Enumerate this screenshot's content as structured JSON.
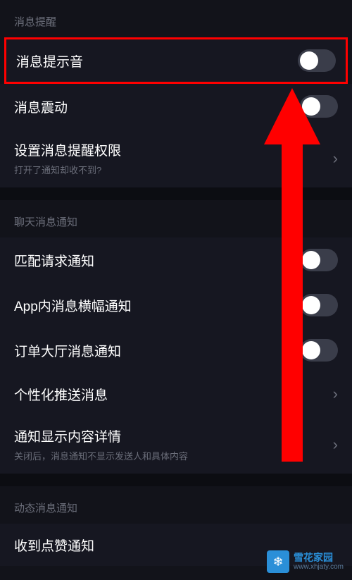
{
  "sections": {
    "notifications": {
      "header": "消息提醒",
      "sound": {
        "label": "消息提示音"
      },
      "vibrate": {
        "label": "消息震动"
      },
      "permission": {
        "label": "设置消息提醒权限",
        "sub": "打开了通知却收不到?"
      }
    },
    "chat": {
      "header": "聊天消息通知",
      "match": {
        "label": "匹配请求通知"
      },
      "banner": {
        "label": "App内消息横幅通知"
      },
      "order": {
        "label": "订单大厅消息通知"
      },
      "personal": {
        "label": "个性化推送消息"
      },
      "detail": {
        "label": "通知显示内容详情",
        "sub": "关闭后，消息通知不显示发送人和具体内容"
      }
    },
    "dynamic": {
      "header": "动态消息通知",
      "like": {
        "label": "收到点赞通知"
      }
    }
  },
  "watermark": {
    "name": "雪花家园",
    "url": "www.xhjaty.com"
  }
}
